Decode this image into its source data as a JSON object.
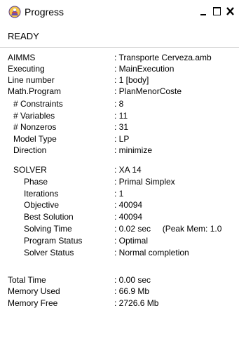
{
  "window": {
    "title": "Progress",
    "controls": [
      "_",
      "□",
      "X"
    ]
  },
  "status": "READY",
  "rows": [
    {
      "label": "AIMMS",
      "value": ": Transporte Cerveza.amb"
    },
    {
      "label": "Executing",
      "value": ": MainExecution"
    },
    {
      "label": "Line number",
      "value": ": 1 [body]"
    },
    {
      "label": "Math.Program",
      "value": ": PlanMenorCoste"
    },
    {
      "label": "# Constraints",
      "value": ": 8"
    },
    {
      "label": "# Variables",
      "value": ": 11"
    },
    {
      "label": "# Nonzeros",
      "value": ": 31"
    },
    {
      "label": "Model Type",
      "value": ": LP"
    },
    {
      "label": "Direction",
      "value": ": minimize"
    },
    {
      "label": "SOLVER",
      "value": ": XA 14"
    },
    {
      "label": "Phase",
      "value": ": Primal Simplex"
    },
    {
      "label": "Iterations",
      "value": ": 1"
    },
    {
      "label": "Objective",
      "value": ": 40094"
    },
    {
      "label": "Best Solution",
      "value": ": 40094"
    },
    {
      "label": "Solving Time",
      "value": ": 0.02 sec     (Peak Mem: 1.0"
    },
    {
      "label": "Program Status",
      "value": ": Optimal"
    },
    {
      "label": "Solver Status",
      "value": ": Normal completion"
    },
    {
      "label": "Total Time",
      "value": ": 0.00 sec"
    },
    {
      "label": "Memory Used",
      "value": ": 66.9 Mb"
    },
    {
      "label": "Memory Free",
      "value": ": 2726.6 Mb"
    }
  ]
}
